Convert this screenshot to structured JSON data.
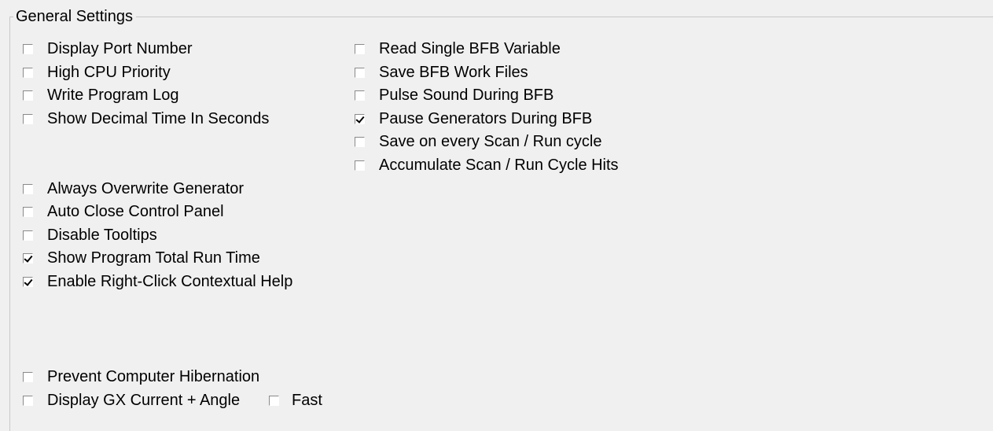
{
  "group_title": "General Settings",
  "checkboxes": {
    "display_port_number": {
      "label": "Display Port Number",
      "checked": false
    },
    "high_cpu_priority": {
      "label": "High CPU Priority",
      "checked": false
    },
    "write_program_log": {
      "label": "Write Program Log",
      "checked": false
    },
    "show_decimal_time": {
      "label": "Show Decimal Time In Seconds",
      "checked": false
    },
    "read_single_bfb": {
      "label": "Read Single BFB Variable",
      "checked": false
    },
    "save_bfb_work_files": {
      "label": "Save BFB Work Files",
      "checked": false
    },
    "pulse_sound_bfb": {
      "label": "Pulse Sound During BFB",
      "checked": false
    },
    "pause_generators_bfb": {
      "label": "Pause Generators During BFB",
      "checked": true
    },
    "save_every_scan": {
      "label": "Save on every Scan / Run cycle",
      "checked": false
    },
    "accumulate_hits": {
      "label": "Accumulate Scan / Run Cycle Hits",
      "checked": false
    },
    "always_overwrite_generator": {
      "label": "Always Overwrite Generator",
      "checked": false
    },
    "auto_close_control_panel": {
      "label": "Auto Close Control Panel",
      "checked": false
    },
    "disable_tooltips": {
      "label": "Disable Tooltips",
      "checked": false
    },
    "show_total_run_time": {
      "label": "Show Program Total Run Time",
      "checked": true
    },
    "enable_right_click_help": {
      "label": "Enable Right-Click Contextual Help",
      "checked": true
    },
    "prevent_hibernation": {
      "label": "Prevent Computer Hibernation",
      "checked": false
    },
    "display_gx_current_angle": {
      "label": "Display GX Current + Angle",
      "checked": false
    },
    "fast": {
      "label": "Fast",
      "checked": false
    }
  }
}
